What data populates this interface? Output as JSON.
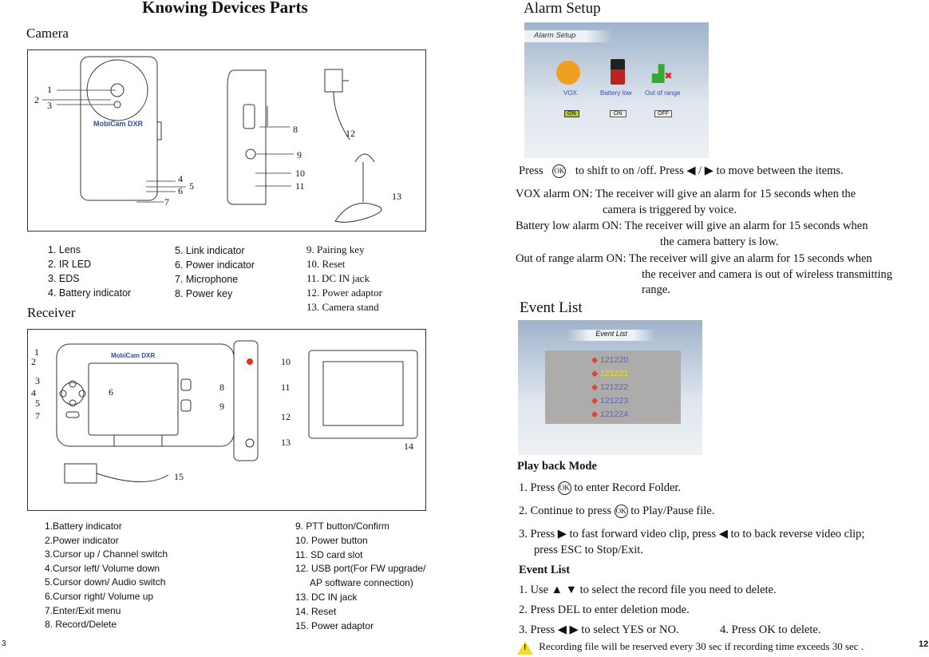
{
  "left": {
    "title": "Knowing Devices Parts",
    "camera_heading": "Camera",
    "camera_callouts": [
      "1",
      "2",
      "3",
      "4",
      "5",
      "6",
      "7",
      "8",
      "9",
      "10",
      "11",
      "12",
      "13"
    ],
    "brand": "MobiCam DXR",
    "camera_parts_col1": [
      "1. Lens",
      "2. IR LED",
      "3. EDS",
      "4. Battery indicator"
    ],
    "camera_parts_col2": [
      "5. Link indicator",
      "6. Power indicator",
      "7. Microphone",
      "8. Power key"
    ],
    "camera_parts_col3": [
      "9. Pairing key",
      "10. Reset",
      "11. DC IN jack",
      "12. Power adaptor",
      "13. Camera stand"
    ],
    "receiver_heading": "Receiver",
    "receiver_callouts": [
      "1",
      "2",
      "3",
      "4",
      "5",
      "6",
      "7",
      "8",
      "9",
      "10",
      "11",
      "12",
      "13",
      "14",
      "15"
    ],
    "receiver_parts_col1": [
      "1.Battery indicator",
      "2.Power indicator",
      "3.Cursor up / Channel switch",
      "4.Cursor left/ Volume down",
      "5.Cursor down/ Audio switch",
      "6.Cursor right/ Volume up",
      "7.Enter/Exit menu",
      "8. Record/Delete"
    ],
    "receiver_parts_col2": [
      "9. PTT button/Confirm",
      "10. Power button",
      "11. SD card slot",
      "12. USB port(For FW upgrade/",
      "AP software connection)",
      "13. DC IN jack",
      "14. Reset",
      "15. Power adaptor"
    ],
    "page_number": "3"
  },
  "right": {
    "alarm_heading": "Alarm Setup",
    "alarm_screen": {
      "title": "Alarm Setup",
      "items": [
        {
          "label": "VOX",
          "state": "ON",
          "selected": true
        },
        {
          "label": "Battery low",
          "state": "ON",
          "selected": false
        },
        {
          "label": "Out of range",
          "state": "OFF",
          "selected": false
        }
      ]
    },
    "press_line": {
      "a": "Press",
      "ok": "OK",
      "b": "to shift to on /off. Press ◀ / ▶ to move between the items."
    },
    "alarms": [
      {
        "label": "VOX alarm ON:",
        "lines": [
          "The receiver will give an alarm for 15 seconds when the",
          "camera is triggered by voice."
        ]
      },
      {
        "label": "Battery low alarm ON:",
        "lines": [
          "The receiver will give an alarm for 15 seconds when",
          "the camera battery is low."
        ]
      },
      {
        "label": "Out of range alarm ON:",
        "lines": [
          "The receiver will give an alarm for 15 seconds when",
          "the receiver and camera is out of wireless transmitting",
          "range."
        ]
      }
    ],
    "event_heading": "Event List",
    "event_screen": {
      "title": "Event List",
      "items": [
        "121220",
        "121221",
        "121222",
        "121223",
        "121224"
      ],
      "selected_index": 1,
      "selected_color": "#e8e020",
      "item_color": "#5a62b8"
    },
    "playback": {
      "heading": "Play back Mode",
      "s1a": "1.  Press",
      "s1b": "to enter Record Folder.",
      "s2a": "2.  Continue to press",
      "s2b": "to Play/Pause file.",
      "s3": "3.  Press ▶ to fast forward video clip, press ◀ to to back reverse video clip;",
      "s3b": "press ESC to Stop/Exit."
    },
    "eventlist": {
      "heading": "Event List",
      "s1": "1.  Use ▲ ▼ to select  the record file you need to delete.",
      "s2": "2.  Press DEL to enter deletion mode.",
      "s3": "3.  Press ◀  ▶ to select YES or NO.",
      "s4": "4.  Press OK  to delete."
    },
    "note": "Recording file will be reserved every 30 sec if recording time  exceeds  30 sec .",
    "page_number": "12"
  }
}
